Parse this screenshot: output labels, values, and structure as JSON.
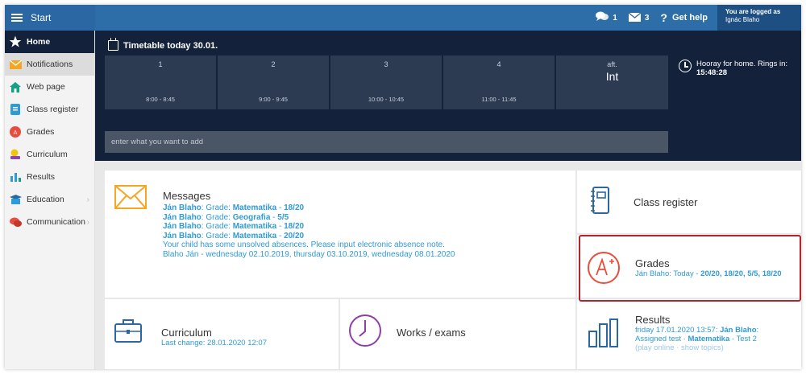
{
  "topbar": {
    "start_label": "Start",
    "chat_count": "1",
    "mail_count": "3",
    "help_label": "Get help",
    "logged_label": "You are logged as",
    "user_name": "Ignác Blaho"
  },
  "sidebar": {
    "items": [
      {
        "label": "Home",
        "icon": "star-icon"
      },
      {
        "label": "Notifications",
        "icon": "envelope-icon"
      },
      {
        "label": "Web page",
        "icon": "house-icon"
      },
      {
        "label": "Class register",
        "icon": "register-icon"
      },
      {
        "label": "Grades",
        "icon": "grades-icon"
      },
      {
        "label": "Curriculum",
        "icon": "curriculum-icon"
      },
      {
        "label": "Results",
        "icon": "bar-chart-icon"
      },
      {
        "label": "Education",
        "icon": "education-icon"
      },
      {
        "label": "Communication",
        "icon": "chat-icon"
      }
    ],
    "chevron": "›"
  },
  "timetable": {
    "title": "Timetable today 30.01.",
    "lessons": [
      {
        "num": "1",
        "time": "8:00 - 8:45",
        "subject": ""
      },
      {
        "num": "2",
        "time": "9:00 - 9:45",
        "subject": ""
      },
      {
        "num": "3",
        "time": "10:00 - 10:45",
        "subject": ""
      },
      {
        "num": "4",
        "time": "11:00 - 11:45",
        "subject": ""
      },
      {
        "num": "aft.",
        "time": "",
        "subject": "Int"
      }
    ],
    "rings_text": "Hooray for home. Rings in:",
    "rings_time": "15:48:28",
    "input_placeholder": "enter what you want to add"
  },
  "messages": {
    "title": "Messages",
    "sender": "Ján Blaho",
    "grade_label": ": Grade: ",
    "lines": [
      {
        "subject": "Matematika",
        "score": "18/20"
      },
      {
        "subject": "Geografia",
        "score": "5/5"
      },
      {
        "subject": "Matematika",
        "score": "18/20"
      },
      {
        "subject": "Matematika",
        "score": "20/20"
      }
    ],
    "sep": " - ",
    "absence_note": "Your child has some unsolved absences. Please input electronic absence note.",
    "absence_dates": "Blaho Ján - wednesday 02.10.2019, thursday 03.10.2019, wednesday 08.01.2020"
  },
  "class_register": {
    "title": "Class register"
  },
  "grades": {
    "title": "Grades",
    "prefix": "Ján Blaho: Today - ",
    "values": "20/20, 18/20, 5/5, 18/20"
  },
  "curriculum": {
    "title": "Curriculum",
    "last_change": "Last change: 28.01.2020 12:07"
  },
  "works": {
    "title": "Works / exams"
  },
  "results": {
    "title": "Results",
    "line1a": "friday 17.01.2020 13:57: ",
    "line1b": "Ján Blaho",
    "line1c": ":",
    "line2a": "Assigned test · ",
    "line2b": "Matematika",
    "line2c": " · Test 2",
    "line3": "(play online · show topics)"
  },
  "colors": {
    "accent": "#2e9ad6",
    "nav": "#13213a",
    "topbar": "#2d6da8",
    "highlight": "#b2252a",
    "orange": "#f5a623",
    "purple": "#8e3fa5"
  }
}
